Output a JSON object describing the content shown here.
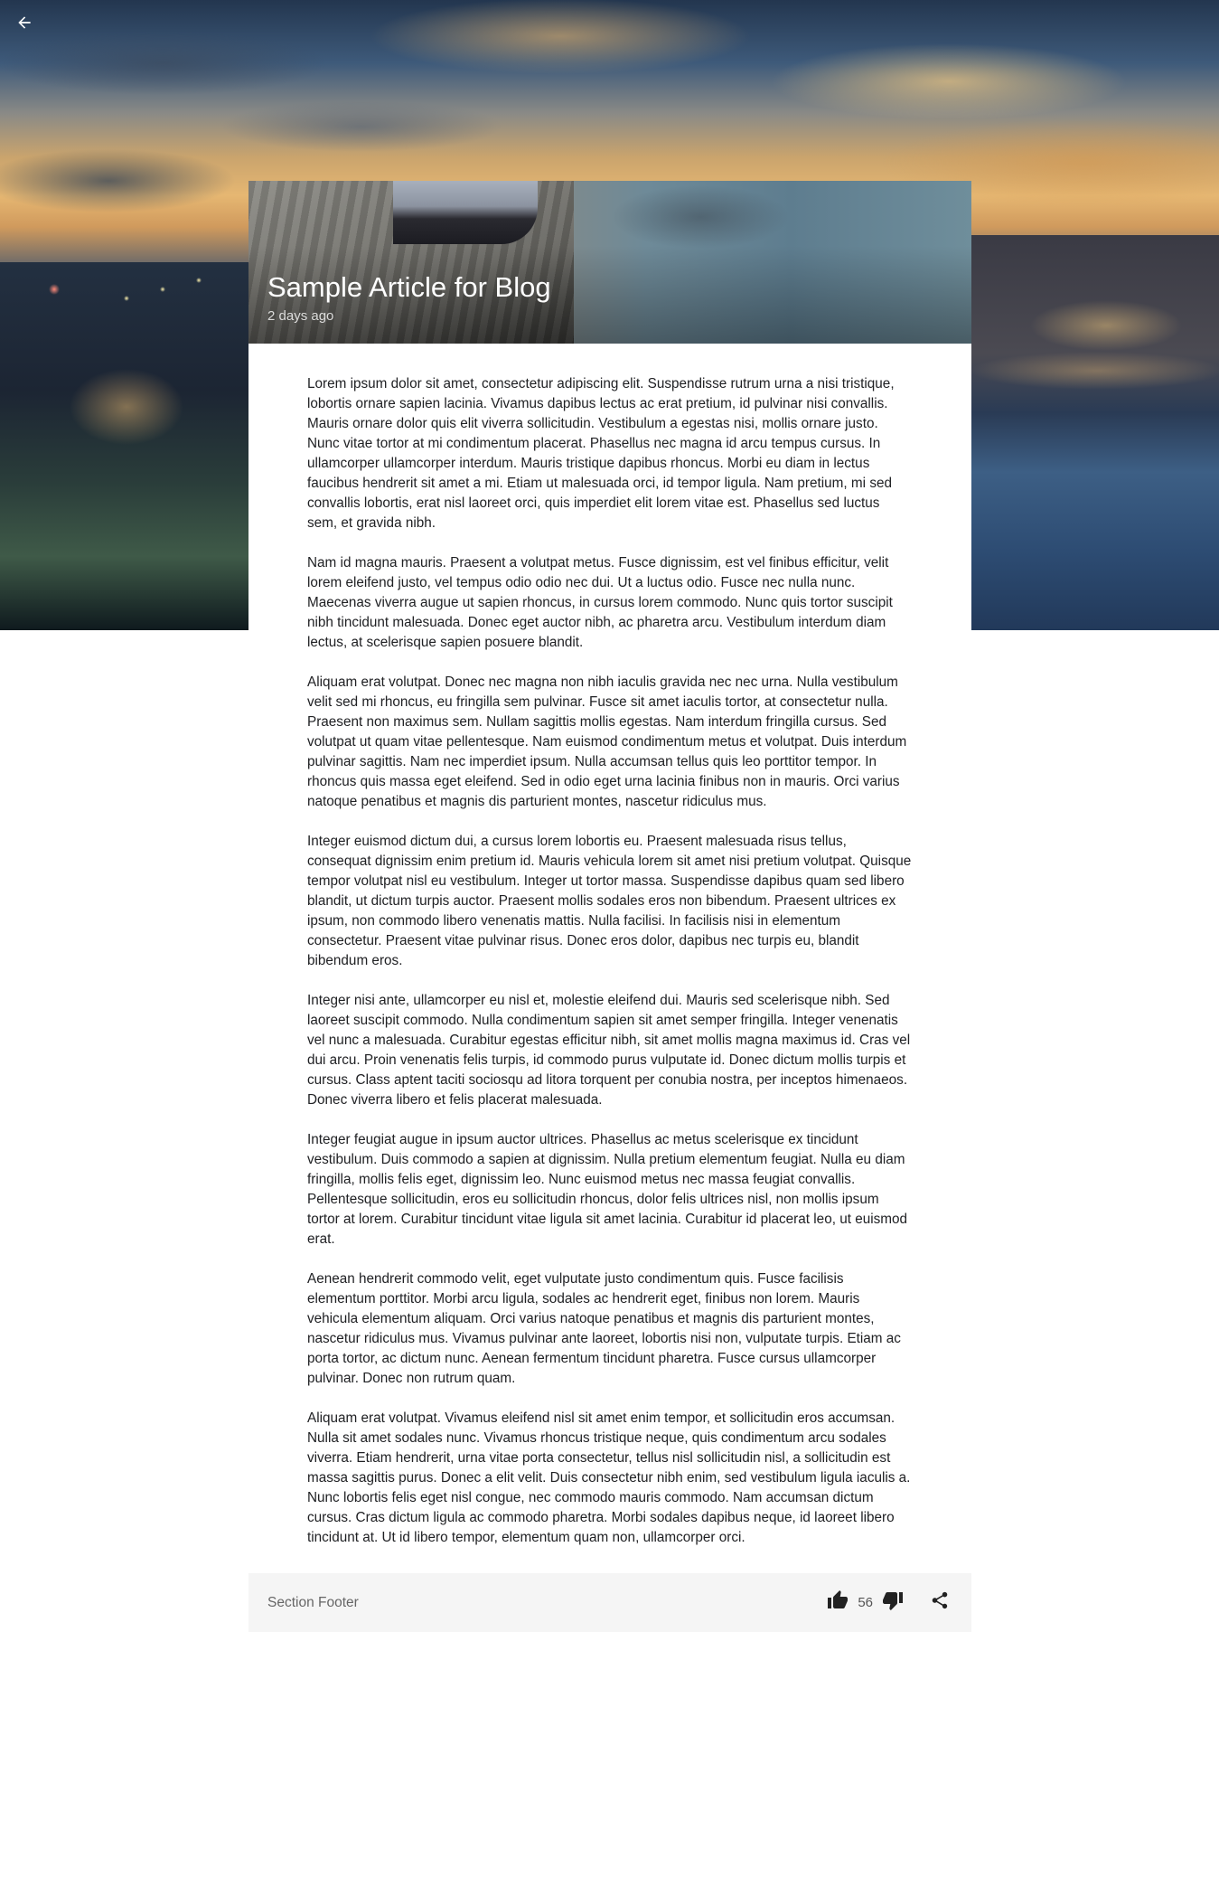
{
  "nav": {
    "back_icon": "arrow-back-icon"
  },
  "article": {
    "title": "Sample Article for Blog",
    "subtitle": "2 days ago",
    "paragraphs": [
      "Lorem ipsum dolor sit amet, consectetur adipiscing elit. Suspendisse rutrum urna a nisi tristique, lobortis ornare sapien lacinia. Vivamus dapibus lectus ac erat pretium, id pulvinar nisi convallis. Mauris ornare dolor quis elit viverra sollicitudin. Vestibulum a egestas nisi, mollis ornare justo. Nunc vitae tortor at mi condimentum placerat. Phasellus nec magna id arcu tempus cursus. In ullamcorper ullamcorper interdum. Mauris tristique dapibus rhoncus. Morbi eu diam in lectus faucibus hendrerit sit amet a mi. Etiam ut malesuada orci, id tempor ligula. Nam pretium, mi sed convallis lobortis, erat nisl laoreet orci, quis imperdiet elit lorem vitae est. Phasellus sed luctus sem, et gravida nibh.",
      "Nam id magna mauris. Praesent a volutpat metus. Fusce dignissim, est vel finibus efficitur, velit lorem eleifend justo, vel tempus odio odio nec dui. Ut a luctus odio. Fusce nec nulla nunc. Maecenas viverra augue ut sapien rhoncus, in cursus lorem commodo. Nunc quis tortor suscipit nibh tincidunt malesuada. Donec eget auctor nibh, ac pharetra arcu. Vestibulum interdum diam lectus, at scelerisque sapien posuere blandit.",
      "Aliquam erat volutpat. Donec nec magna non nibh iaculis gravida nec nec urna. Nulla vestibulum velit sed mi rhoncus, eu fringilla sem pulvinar. Fusce sit amet iaculis tortor, at consectetur nulla. Praesent non maximus sem. Nullam sagittis mollis egestas. Nam interdum fringilla cursus. Sed volutpat ut quam vitae pellentesque. Nam euismod condimentum metus et volutpat. Duis interdum pulvinar sagittis. Nam nec imperdiet ipsum. Nulla accumsan tellus quis leo porttitor tempor. In rhoncus quis massa eget eleifend. Sed in odio eget urna lacinia finibus non in mauris. Orci varius natoque penatibus et magnis dis parturient montes, nascetur ridiculus mus.",
      "Integer euismod dictum dui, a cursus lorem lobortis eu. Praesent malesuada risus tellus, consequat dignissim enim pretium id. Mauris vehicula lorem sit amet nisi pretium volutpat. Quisque tempor volutpat nisl eu vestibulum. Integer ut tortor massa. Suspendisse dapibus quam sed libero blandit, ut dictum turpis auctor. Praesent mollis sodales eros non bibendum. Praesent ultrices ex ipsum, non commodo libero venenatis mattis. Nulla facilisi. In facilisis nisi in elementum consectetur. Praesent vitae pulvinar risus. Donec eros dolor, dapibus nec turpis eu, blandit bibendum eros.",
      "Integer nisi ante, ullamcorper eu nisl et, molestie eleifend dui. Mauris sed scelerisque nibh. Sed laoreet suscipit commodo. Nulla condimentum sapien sit amet semper fringilla. Integer venenatis vel nunc a malesuada. Curabitur egestas efficitur nibh, sit amet mollis magna maximus id. Cras vel dui arcu. Proin venenatis felis turpis, id commodo purus vulputate id. Donec dictum mollis turpis et cursus. Class aptent taciti sociosqu ad litora torquent per conubia nostra, per inceptos himenaeos. Donec viverra libero et felis placerat malesuada.",
      "Integer feugiat augue in ipsum auctor ultrices. Phasellus ac metus scelerisque ex tincidunt vestibulum. Duis commodo a sapien at dignissim. Nulla pretium elementum feugiat. Nulla eu diam fringilla, mollis felis eget, dignissim leo. Nunc euismod metus nec massa feugiat convallis. Pellentesque sollicitudin, eros eu sollicitudin rhoncus, dolor felis ultrices nisl, non mollis ipsum tortor at lorem. Curabitur tincidunt vitae ligula sit amet lacinia. Curabitur id placerat leo, ut euismod erat.",
      "Aenean hendrerit commodo velit, eget vulputate justo condimentum quis. Fusce facilisis elementum porttitor. Morbi arcu ligula, sodales ac hendrerit eget, finibus non lorem. Mauris vehicula elementum aliquam. Orci varius natoque penatibus et magnis dis parturient montes, nascetur ridiculus mus. Vivamus pulvinar ante laoreet, lobortis nisi non, vulputate turpis. Etiam ac porta tortor, ac dictum nunc. Aenean fermentum tincidunt pharetra. Fusce cursus ullamcorper pulvinar. Donec non rutrum quam.",
      "Aliquam erat volutpat. Vivamus eleifend nisl sit amet enim tempor, et sollicitudin eros accumsan. Nulla sit amet sodales nunc. Vivamus rhoncus tristique neque, quis condimentum arcu sodales viverra. Etiam hendrerit, urna vitae porta consectetur, tellus nisl sollicitudin nisl, a sollicitudin est massa sagittis purus. Donec a elit velit. Duis consectetur nibh enim, sed vestibulum ligula iaculis a. Nunc lobortis felis eget nisl congue, nec commodo mauris commodo. Nam accumsan dictum cursus. Cras dictum ligula ac commodo pharetra. Morbi sodales dapibus neque, id laoreet libero tincidunt at. Ut id libero tempor, elementum quam non, ullamcorper orci."
    ]
  },
  "footer": {
    "label": "Section Footer",
    "like_count": "56",
    "icons": [
      "thumb-up-icon",
      "thumb-down-icon",
      "share-icon"
    ]
  }
}
